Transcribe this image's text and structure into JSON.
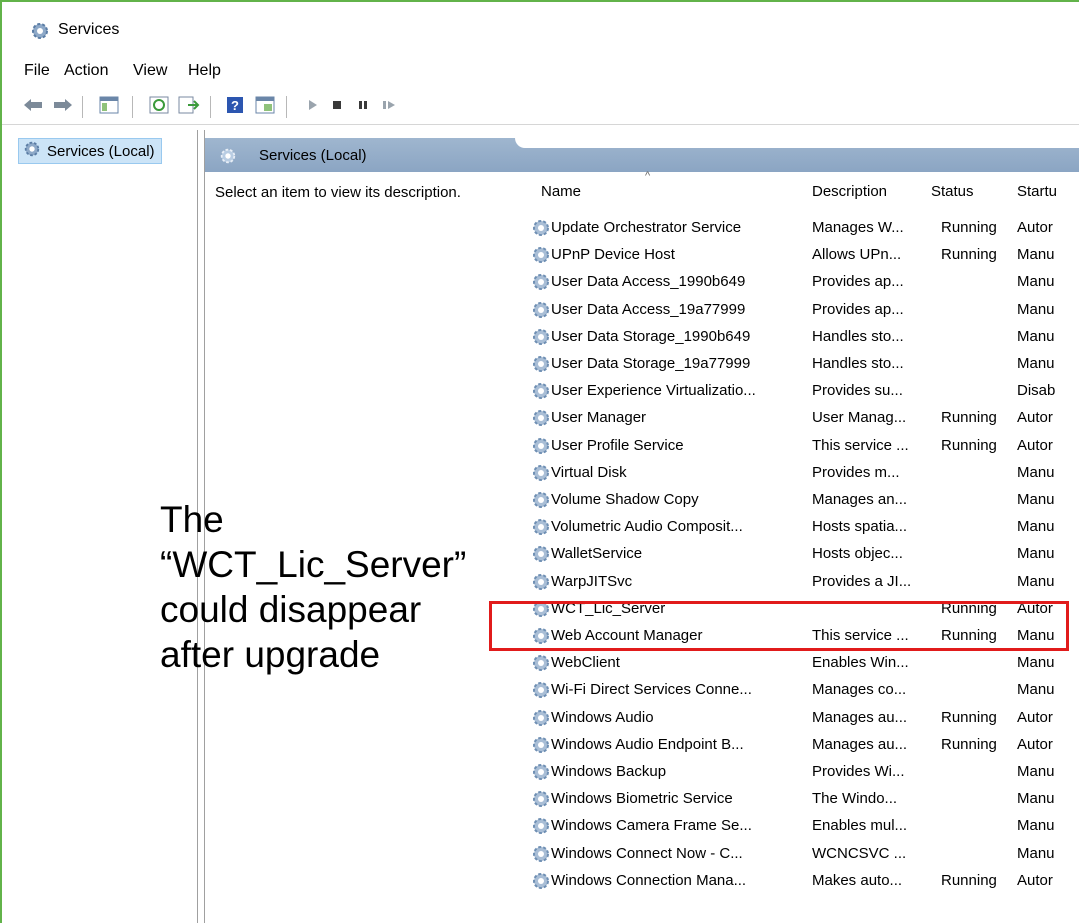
{
  "window": {
    "title": "Services"
  },
  "menu": [
    "File",
    "Action",
    "View",
    "Help"
  ],
  "toolbar": {
    "buttons": [
      "back-icon",
      "forward-icon",
      "show-hide-console-tree-icon",
      "refresh-icon",
      "export-list-icon",
      "help-icon",
      "properties-icon",
      "start-service-icon",
      "stop-service-icon",
      "pause-service-icon",
      "restart-service-icon"
    ]
  },
  "tree": {
    "root_label": "Services (Local)"
  },
  "panel": {
    "header_title": "Services (Local)",
    "description_hint": "Select an item to view its description."
  },
  "columns": {
    "name": "Name",
    "description": "Description",
    "status": "Status",
    "startup": "Startu"
  },
  "services": [
    {
      "name": "Update Orchestrator Service",
      "description": "Manages W...",
      "status": "Running",
      "startup": "Autor"
    },
    {
      "name": "UPnP Device Host",
      "description": "Allows UPn...",
      "status": "Running",
      "startup": "Manu"
    },
    {
      "name": "User Data Access_1990b649",
      "description": "Provides ap...",
      "status": "",
      "startup": "Manu"
    },
    {
      "name": "User Data Access_19a77999",
      "description": "Provides ap...",
      "status": "",
      "startup": "Manu"
    },
    {
      "name": "User Data Storage_1990b649",
      "description": "Handles sto...",
      "status": "",
      "startup": "Manu"
    },
    {
      "name": "User Data Storage_19a77999",
      "description": "Handles sto...",
      "status": "",
      "startup": "Manu"
    },
    {
      "name": "User Experience Virtualizatio...",
      "description": "Provides su...",
      "status": "",
      "startup": "Disab"
    },
    {
      "name": "User Manager",
      "description": "User Manag...",
      "status": "Running",
      "startup": "Autor"
    },
    {
      "name": "User Profile Service",
      "description": "This service ...",
      "status": "Running",
      "startup": "Autor"
    },
    {
      "name": "Virtual Disk",
      "description": "Provides m...",
      "status": "",
      "startup": "Manu"
    },
    {
      "name": "Volume Shadow Copy",
      "description": "Manages an...",
      "status": "",
      "startup": "Manu"
    },
    {
      "name": "Volumetric Audio Composit...",
      "description": "Hosts spatia...",
      "status": "",
      "startup": "Manu"
    },
    {
      "name": "WalletService",
      "description": "Hosts objec...",
      "status": "",
      "startup": "Manu"
    },
    {
      "name": "WarpJITSvc",
      "description": "Provides a JI...",
      "status": "",
      "startup": "Manu"
    },
    {
      "name": "WCT_Lic_Server",
      "description": "",
      "status": "Running",
      "startup": "Autor"
    },
    {
      "name": "Web Account Manager",
      "description": "This service ...",
      "status": "Running",
      "startup": "Manu"
    },
    {
      "name": "WebClient",
      "description": "Enables Win...",
      "status": "",
      "startup": "Manu"
    },
    {
      "name": "Wi-Fi Direct Services Conne...",
      "description": "Manages co...",
      "status": "",
      "startup": "Manu"
    },
    {
      "name": "Windows Audio",
      "description": "Manages au...",
      "status": "Running",
      "startup": "Autor"
    },
    {
      "name": "Windows Audio Endpoint B...",
      "description": "Manages au...",
      "status": "Running",
      "startup": "Autor"
    },
    {
      "name": "Windows Backup",
      "description": "Provides Wi...",
      "status": "",
      "startup": "Manu"
    },
    {
      "name": "Windows Biometric Service",
      "description": "The Windo...",
      "status": "",
      "startup": "Manu"
    },
    {
      "name": "Windows Camera Frame Se...",
      "description": "Enables mul...",
      "status": "",
      "startup": "Manu"
    },
    {
      "name": "Windows Connect Now - C...",
      "description": "WCNCSVC ...",
      "status": "",
      "startup": "Manu"
    },
    {
      "name": "Windows Connection Mana...",
      "description": "Makes auto...",
      "status": "Running",
      "startup": "Autor"
    }
  ],
  "annotation": {
    "text": "The “WCT_Lic_Server” could disappear after upgrade",
    "highlight_color": "#e11b1b"
  }
}
